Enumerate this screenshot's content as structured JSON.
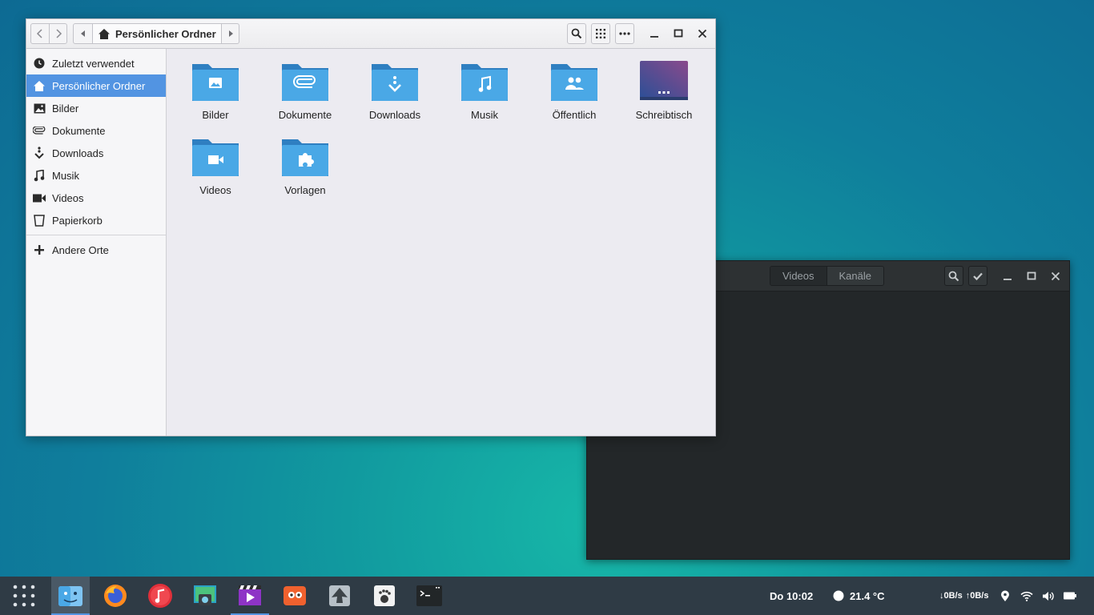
{
  "file_manager": {
    "path_label": "Persönlicher Ordner",
    "sidebar": {
      "items": [
        {
          "label": "Zuletzt verwendet",
          "icon": "clock-icon"
        },
        {
          "label": "Persönlicher Ordner",
          "icon": "home-icon",
          "active": true
        },
        {
          "label": "Bilder",
          "icon": "image-icon"
        },
        {
          "label": "Dokumente",
          "icon": "paperclip-icon"
        },
        {
          "label": "Downloads",
          "icon": "download-icon"
        },
        {
          "label": "Musik",
          "icon": "music-note-icon"
        },
        {
          "label": "Videos",
          "icon": "video-camera-icon"
        },
        {
          "label": "Papierkorb",
          "icon": "trash-icon"
        }
      ],
      "other_places": "Andere Orte"
    },
    "folders": [
      {
        "label": "Bilder",
        "icon": "image-folder-icon"
      },
      {
        "label": "Dokumente",
        "icon": "paperclip-folder-icon"
      },
      {
        "label": "Downloads",
        "icon": "download-folder-icon"
      },
      {
        "label": "Musik",
        "icon": "music-folder-icon"
      },
      {
        "label": "Öffentlich",
        "icon": "people-folder-icon"
      },
      {
        "label": "Schreibtisch",
        "icon": "desktop-folder-icon"
      },
      {
        "label": "Videos",
        "icon": "video-folder-icon"
      },
      {
        "label": "Vorlagen",
        "icon": "puzzle-folder-icon"
      }
    ]
  },
  "video_window": {
    "tabs": [
      "Videos",
      "Kanäle"
    ]
  },
  "panel": {
    "clock": "Do 10:02",
    "weather": "21.4 °C",
    "net_down": "↓0B/s",
    "net_up": "↑0B/s",
    "apps": [
      "file-manager-icon",
      "firefox-icon",
      "music-player-icon",
      "screenshot-icon",
      "video-editor-icon",
      "gimp-icon",
      "inkscape-icon",
      "gnome-foot-icon",
      "terminal-icon"
    ]
  },
  "colors": {
    "accent": "#5294e2",
    "folder": "#4aa8e6",
    "panel": "#2f3b45"
  }
}
